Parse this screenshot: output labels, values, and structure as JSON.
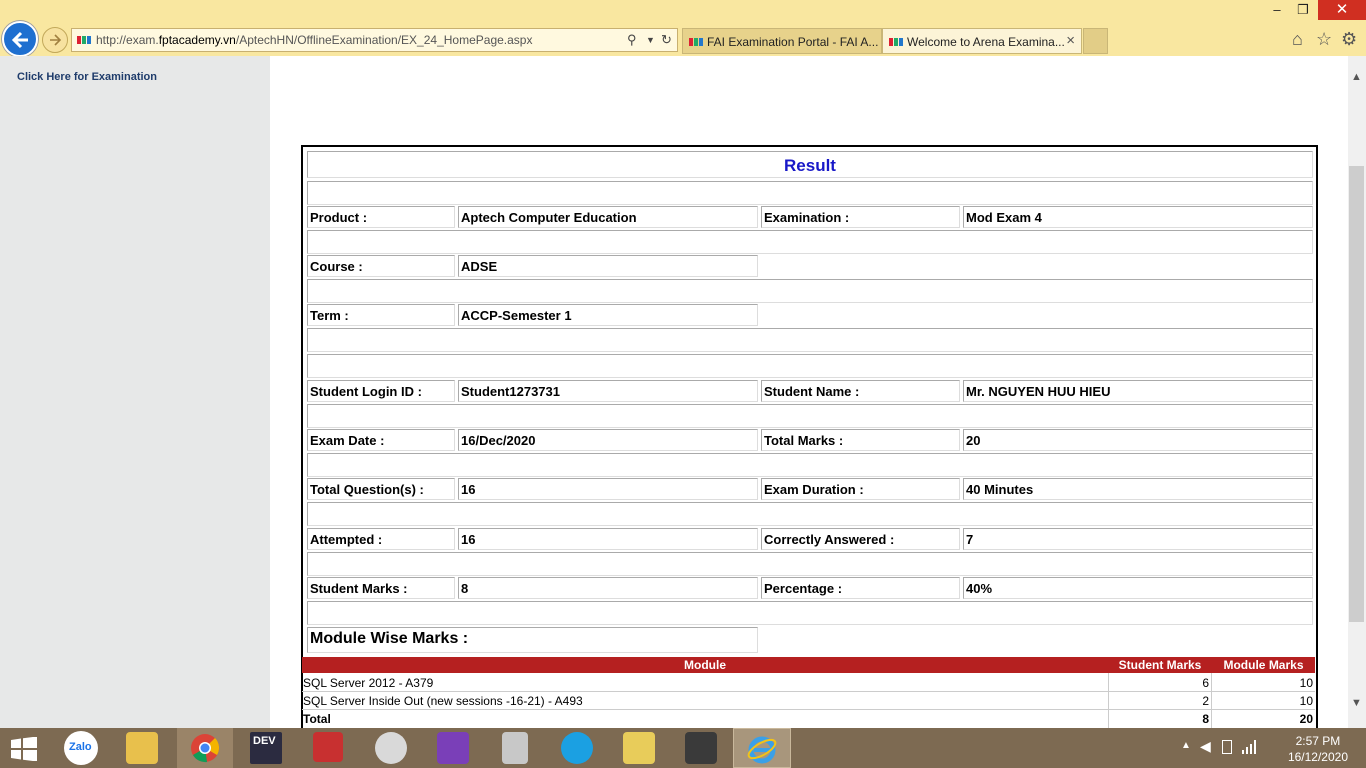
{
  "browser": {
    "url_prefix": "http://exam.",
    "url_domain": "fptacademy.vn",
    "url_path": "/AptechHN/OfflineExamination/EX_24_HomePage.aspx",
    "tabs": [
      {
        "label": "FAI Examination Portal - FAI A..."
      },
      {
        "label": "Welcome to Arena Examina..."
      }
    ],
    "close_tab_glyph": "×",
    "minimize_glyph": "–",
    "restore_glyph": "❐",
    "close_glyph": "✕"
  },
  "sidebar": {
    "exam_link": "Click Here for Examination"
  },
  "result": {
    "title": "Result",
    "product_label": "Product :",
    "product_value": "Aptech Computer Education",
    "examination_label": "Examination :",
    "examination_value": "Mod Exam 4",
    "course_label": "Course :",
    "course_value": "ADSE",
    "term_label": "Term :",
    "term_value": "ACCP-Semester 1",
    "login_label": "Student Login ID :",
    "login_value": "Student1273731",
    "name_label": "Student Name :",
    "name_value": "Mr. NGUYEN HUU HIEU",
    "exam_date_label": "Exam Date :",
    "exam_date_value": "16/Dec/2020",
    "total_marks_label": "Total Marks :",
    "total_marks_value": "20",
    "total_questions_label": "Total Question(s) :",
    "total_questions_value": "16",
    "duration_label": "Exam Duration :",
    "duration_value": "40 Minutes",
    "attempted_label": "Attempted :",
    "attempted_value": "16",
    "correct_label": "Correctly Answered :",
    "correct_value": "7",
    "student_marks_label": "Student Marks :",
    "student_marks_value": "8",
    "percentage_label": "Percentage :",
    "percentage_value": "40%",
    "module_wise_title": "Module Wise Marks :"
  },
  "modules": {
    "headers": {
      "module": "Module",
      "student_marks": "Student Marks",
      "module_marks": "Module Marks"
    },
    "rows": [
      {
        "module": "SQL Server 2012 - A379",
        "student_marks": "6",
        "module_marks": "10"
      },
      {
        "module": "SQL Server Inside Out (new sessions -16-21) - A493",
        "student_marks": "2",
        "module_marks": "10"
      }
    ],
    "total": {
      "module": "Total",
      "student_marks": "8",
      "module_marks": "20"
    }
  },
  "taskbar": {
    "apps": [
      "windows-start",
      "zalo",
      "file-explorer",
      "chrome",
      "devexpress",
      "app-tool",
      "paint-tool",
      "visual-studio",
      "calculator",
      "skype",
      "file-tool",
      "sublime-text",
      "internet-explorer"
    ],
    "zalo_label": "Zalo",
    "devexpress_label": "DEV",
    "time": "2:57 PM",
    "date": "16/12/2020"
  },
  "colors": {
    "title_bar": "#f9e7a0",
    "result_title": "#1818c8",
    "module_header": "#b52020",
    "taskbar": "#7d6a52"
  }
}
